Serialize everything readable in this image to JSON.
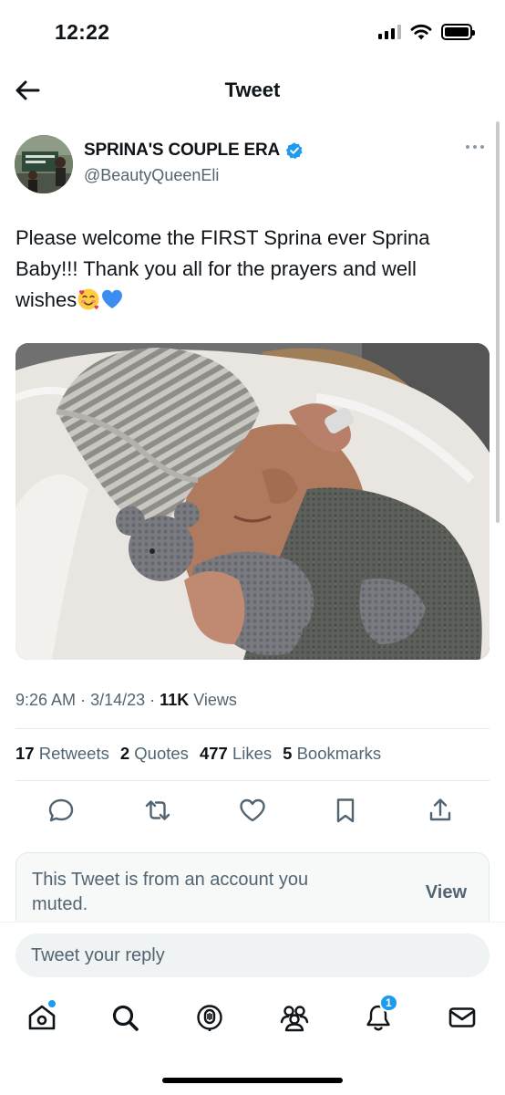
{
  "status_bar": {
    "time": "12:22"
  },
  "header": {
    "title": "Tweet"
  },
  "tweet": {
    "author": {
      "display_name": "SPRINA'S COUPLE ERA",
      "handle": "@BeautyQueenEli",
      "verified": true
    },
    "text": "Please welcome the FIRST Sprina ever Sprina Baby!!! Thank you all for the prayers and well wishes",
    "emojis": [
      "smiling-face-with-hearts",
      "blue-heart"
    ],
    "time": "9:26 AM",
    "date": "3/14/23",
    "views_count": "11K",
    "views_label": "Views",
    "separator": "·",
    "stats": {
      "retweets_count": "17",
      "retweets_label": "Retweets",
      "quotes_count": "2",
      "quotes_label": "Quotes",
      "likes_count": "477",
      "likes_label": "Likes",
      "bookmarks_count": "5",
      "bookmarks_label": "Bookmarks"
    }
  },
  "muted_notice": {
    "text": "This Tweet is from an account you muted.",
    "action": "View"
  },
  "reply": {
    "placeholder": "Tweet your reply"
  },
  "tab_bar": {
    "notifications_badge": "1"
  },
  "colors": {
    "accent": "#1d9bf0",
    "text_primary": "#0f1419",
    "text_secondary": "#536471"
  }
}
